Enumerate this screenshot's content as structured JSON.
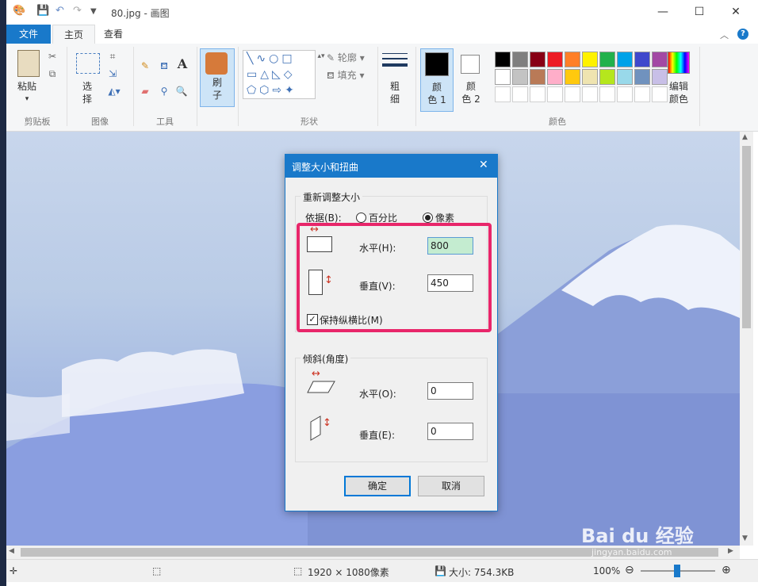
{
  "window": {
    "title": "80.jpg - 画图",
    "minimize": "—",
    "maximize": "☐",
    "close": "✕"
  },
  "tabs": {
    "file": "文件",
    "home": "主页",
    "view": "查看"
  },
  "ribbon": {
    "clipboard": {
      "paste": "粘贴",
      "group": "剪贴板"
    },
    "image": {
      "select_line1": "选",
      "select_line2": "择",
      "group": "图像"
    },
    "tools": {
      "group": "工具"
    },
    "brush": {
      "line1": "刷",
      "line2": "子"
    },
    "shapes": {
      "outline": "轮廓",
      "fill": "填充",
      "group": "形状"
    },
    "size": {
      "line1": "粗",
      "line2": "细"
    },
    "color1": {
      "line1": "颜",
      "line2": "色 1"
    },
    "color2": {
      "line1": "颜",
      "line2": "色 2"
    },
    "edit_colors": {
      "line1": "编辑",
      "line2": "颜色"
    },
    "colors_group": "颜色",
    "palette_row1": [
      "#000000",
      "#7f7f7f",
      "#880015",
      "#ed1c24",
      "#ff7f27",
      "#fff200",
      "#22b14c",
      "#00a2e8",
      "#3f48cc",
      "#a349a4"
    ],
    "palette_row2": [
      "#ffffff",
      "#c3c3c3",
      "#b97a57",
      "#ffaec9",
      "#ffc90e",
      "#efe4b0",
      "#b5e61d",
      "#99d9ea",
      "#7092be",
      "#c8bfe7"
    ],
    "palette_row3": [
      "#ffffff",
      "#ffffff",
      "#ffffff",
      "#ffffff",
      "#ffffff",
      "#ffffff",
      "#ffffff",
      "#ffffff",
      "#ffffff",
      "#ffffff"
    ]
  },
  "dialog": {
    "title": "调整大小和扭曲",
    "resize_group": "重新调整大小",
    "by_label": "依据(B):",
    "percent": "百分比",
    "pixels": "像素",
    "selected_unit": "pixels",
    "horizontal_label": "水平(H):",
    "horizontal_value": "800",
    "vertical_label": "垂直(V):",
    "vertical_value": "450",
    "keep_ratio": "保持纵横比(M)",
    "keep_ratio_checked": true,
    "skew_group": "倾斜(角度)",
    "skew_h_label": "水平(O):",
    "skew_h_value": "0",
    "skew_v_label": "垂直(E):",
    "skew_v_value": "0",
    "ok": "确定",
    "cancel": "取消"
  },
  "status": {
    "dimensions": "1920 × 1080像素",
    "size": "大小: 754.3KB",
    "zoom": "100%"
  },
  "watermark": {
    "brand": "Bai du 经验",
    "url": "jingyan.baidu.com"
  }
}
